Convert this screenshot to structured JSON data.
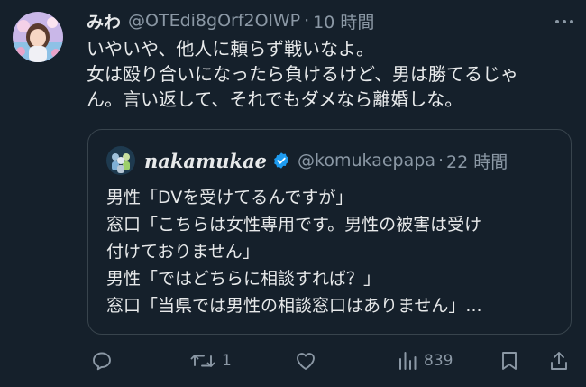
{
  "tweet": {
    "display_name": "みわ",
    "handle": "@OTEdi8gOrf2OlWP",
    "separator": "·",
    "time": "10 時間",
    "lines": [
      "いやいや、他人に頼らず戦いなよ。",
      "女は殴り合いになったら負けるけど、男は勝てるじゃ",
      "ん。言い返して、それでもダメなら離婚しな。"
    ]
  },
  "quote": {
    "display_name": "nakamukae",
    "handle": "@komukaepapa",
    "separator": "·",
    "time": "22 時間",
    "lines": [
      "男性「DVを受けてるんですが」",
      "窓口「こちらは女性専用です。男性の被害は受け",
      "付けておりません」",
      "男性「ではどちらに相談すれば？」",
      "窓口「当県では男性の相談窓口はありません」..."
    ]
  },
  "actions": {
    "reply_count": "",
    "retweet_count": "1",
    "like_count": "",
    "views_count": "839"
  },
  "colors": {
    "background": "#15202b",
    "text": "#e7e9ea",
    "secondary": "#8b98a5",
    "border": "#38444d",
    "verified": "#1d9bf0"
  },
  "icons": [
    "more-icon",
    "verified-icon",
    "reply-icon",
    "retweet-icon",
    "like-icon",
    "views-icon",
    "bookmark-icon",
    "share-icon"
  ]
}
